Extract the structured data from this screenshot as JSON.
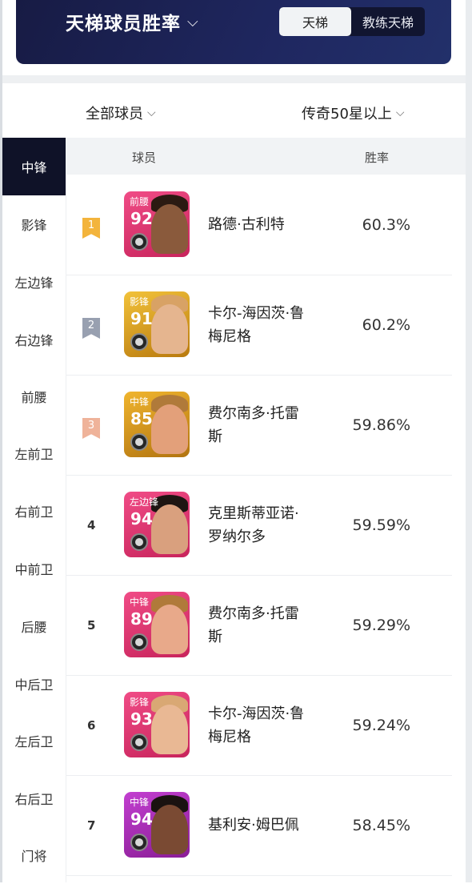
{
  "header": {
    "title": "天梯球员胜率",
    "tabs": [
      {
        "label": "天梯",
        "active": true
      },
      {
        "label": "教练天梯",
        "active": false
      }
    ]
  },
  "filters": {
    "players": "全部球员",
    "rarity": "传奇50星以上"
  },
  "sidebar": {
    "items": [
      "中锋",
      "影锋",
      "左边锋",
      "右边锋",
      "前腰",
      "左前卫",
      "右前卫",
      "中前卫",
      "后腰",
      "中后卫",
      "左后卫",
      "右后卫",
      "门将"
    ],
    "active_index": 0
  },
  "table": {
    "col_player": "球员",
    "col_rate": "胜率",
    "rows": [
      {
        "rank": "1",
        "pos": "前腰",
        "ovr": "92",
        "name_l1": "路德·古利特",
        "name_l2": "",
        "rate": "60.3%"
      },
      {
        "rank": "2",
        "pos": "影锋",
        "ovr": "91",
        "name_l1": "卡尔-海因茨·鲁",
        "name_l2": "梅尼格",
        "rate": "60.2%"
      },
      {
        "rank": "3",
        "pos": "中锋",
        "ovr": "85",
        "name_l1": "费尔南多·托雷",
        "name_l2": "斯",
        "rate": "59.86%"
      },
      {
        "rank": "4",
        "pos": "左边锋",
        "ovr": "94",
        "name_l1": "克里斯蒂亚诺·",
        "name_l2": "罗纳尔多",
        "rate": "59.59%"
      },
      {
        "rank": "5",
        "pos": "中锋",
        "ovr": "89",
        "name_l1": "费尔南多·托雷",
        "name_l2": "斯",
        "rate": "59.29%"
      },
      {
        "rank": "6",
        "pos": "影锋",
        "ovr": "93",
        "name_l1": "卡尔-海因茨·鲁",
        "name_l2": "梅尼格",
        "rate": "59.24%"
      },
      {
        "rank": "7",
        "pos": "中锋",
        "ovr": "94",
        "name_l1": "基利安·姆巴佩",
        "name_l2": "",
        "rate": "58.45%"
      }
    ]
  },
  "colors": {
    "banner": "#1b2150",
    "rank1": "#f3b43c",
    "rank2": "#98a0b0",
    "rank3": "#efb39a",
    "card_pink": "#e2356f",
    "card_gold": "#c98a14",
    "card_purple": "#a52bb0"
  }
}
